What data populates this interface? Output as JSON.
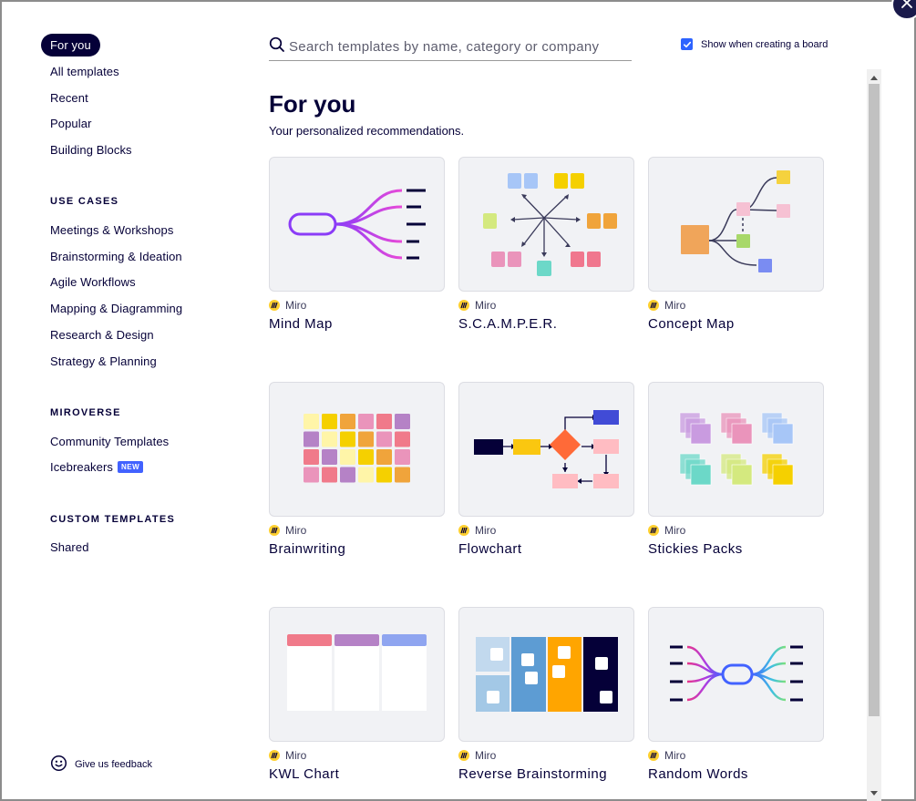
{
  "close": {
    "icon": "close-icon"
  },
  "sidebar": {
    "main_items": [
      {
        "label": "For you",
        "active": true
      },
      {
        "label": "All templates"
      },
      {
        "label": "Recent"
      },
      {
        "label": "Popular"
      },
      {
        "label": "Building Blocks"
      }
    ],
    "use_cases": {
      "heading": "USE CASES",
      "items": [
        {
          "label": "Meetings & Workshops"
        },
        {
          "label": "Brainstorming & Ideation"
        },
        {
          "label": "Agile Workflows"
        },
        {
          "label": "Mapping & Diagramming"
        },
        {
          "label": "Research & Design"
        },
        {
          "label": "Strategy & Planning"
        }
      ]
    },
    "miroverse": {
      "heading": "MIROVERSE",
      "items": [
        {
          "label": "Community Templates"
        },
        {
          "label": "Icebreakers",
          "badge": "NEW"
        }
      ]
    },
    "custom": {
      "heading": "CUSTOM TEMPLATES",
      "items": [
        {
          "label": "Shared"
        }
      ]
    },
    "feedback": {
      "label": "Give us feedback",
      "icon": "smile-icon"
    }
  },
  "search": {
    "placeholder": "Search templates by name, category or company",
    "value": "",
    "icon": "search-icon"
  },
  "show_toggle": {
    "label": "Show when creating a board",
    "checked": true
  },
  "main": {
    "title": "For you",
    "subtitle": "Your personalized recommendations.",
    "cards": [
      {
        "title": "Mind Map",
        "provider": "Miro",
        "thumb": "mindmap"
      },
      {
        "title": "S.C.A.M.P.E.R.",
        "provider": "Miro",
        "thumb": "scamper"
      },
      {
        "title": "Concept Map",
        "provider": "Miro",
        "thumb": "concept"
      },
      {
        "title": "Brainwriting",
        "provider": "Miro",
        "thumb": "brainwriting"
      },
      {
        "title": "Flowchart",
        "provider": "Miro",
        "thumb": "flowchart"
      },
      {
        "title": "Stickies Packs",
        "provider": "Miro",
        "thumb": "stickies"
      },
      {
        "title": "KWL Chart",
        "provider": "Miro",
        "thumb": "kwl"
      },
      {
        "title": "Reverse Brainstorming",
        "provider": "Miro",
        "thumb": "reverse"
      },
      {
        "title": "Random Words",
        "provider": "Miro",
        "thumb": "randomwords"
      }
    ]
  },
  "colors": {
    "accent": "#4262ff",
    "navy": "#050038",
    "checkbox": "#2d63ff",
    "miro_yellow": "#ffd02f"
  }
}
